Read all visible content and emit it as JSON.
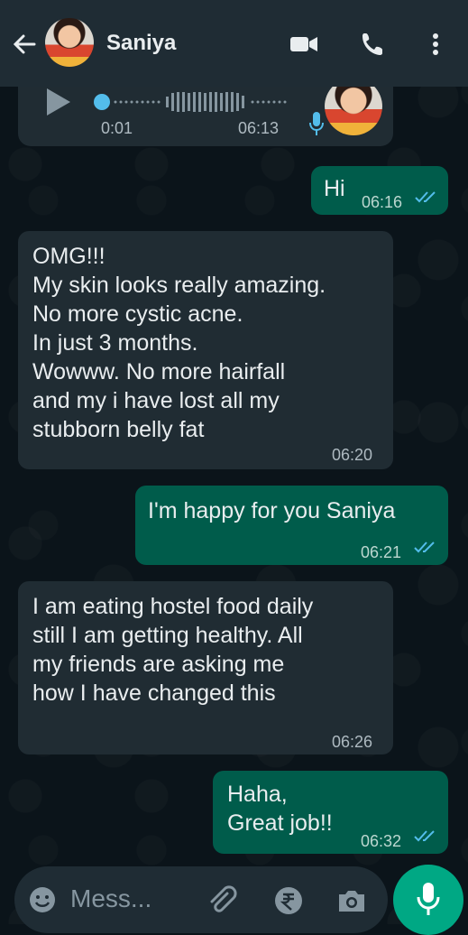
{
  "header": {
    "contact_name": "Saniya"
  },
  "voice_note": {
    "position": "0:01",
    "time": "06:13"
  },
  "messages": [
    {
      "dir": "out",
      "text": "Hi",
      "time": "06:16"
    },
    {
      "dir": "in",
      "lines": [
        "OMG!!!",
        "My skin looks really amazing.",
        "No more cystic acne.",
        "In just 3 months.",
        "Wowww. No more hairfall",
        "and my i have lost all my",
        "stubborn belly fat"
      ],
      "time": "06:20"
    },
    {
      "dir": "out",
      "text": "I'm happy for you Saniya",
      "time": "06:21"
    },
    {
      "dir": "in",
      "lines": [
        "I am eating hostel food daily",
        "still I am getting healthy. All",
        "my friends are asking me",
        "how  I have changed this"
      ],
      "time": "06:26"
    },
    {
      "dir": "out",
      "lines": [
        "Haha,",
        "Great job!!"
      ],
      "time": "06:32"
    }
  ],
  "input": {
    "placeholder": "Mess..."
  },
  "icons": {
    "back": "arrow-left-icon",
    "video": "video-call-icon",
    "call": "phone-icon",
    "more": "more-vertical-icon",
    "emoji": "emoji-icon",
    "attach": "paperclip-icon",
    "payment": "rupee-icon",
    "camera": "camera-icon",
    "mic": "microphone-icon"
  },
  "colors": {
    "header": "#1f2c34",
    "incoming": "#202c33",
    "outgoing": "#005c4b",
    "accent": "#00a884",
    "read_tick": "#53bdeb"
  }
}
